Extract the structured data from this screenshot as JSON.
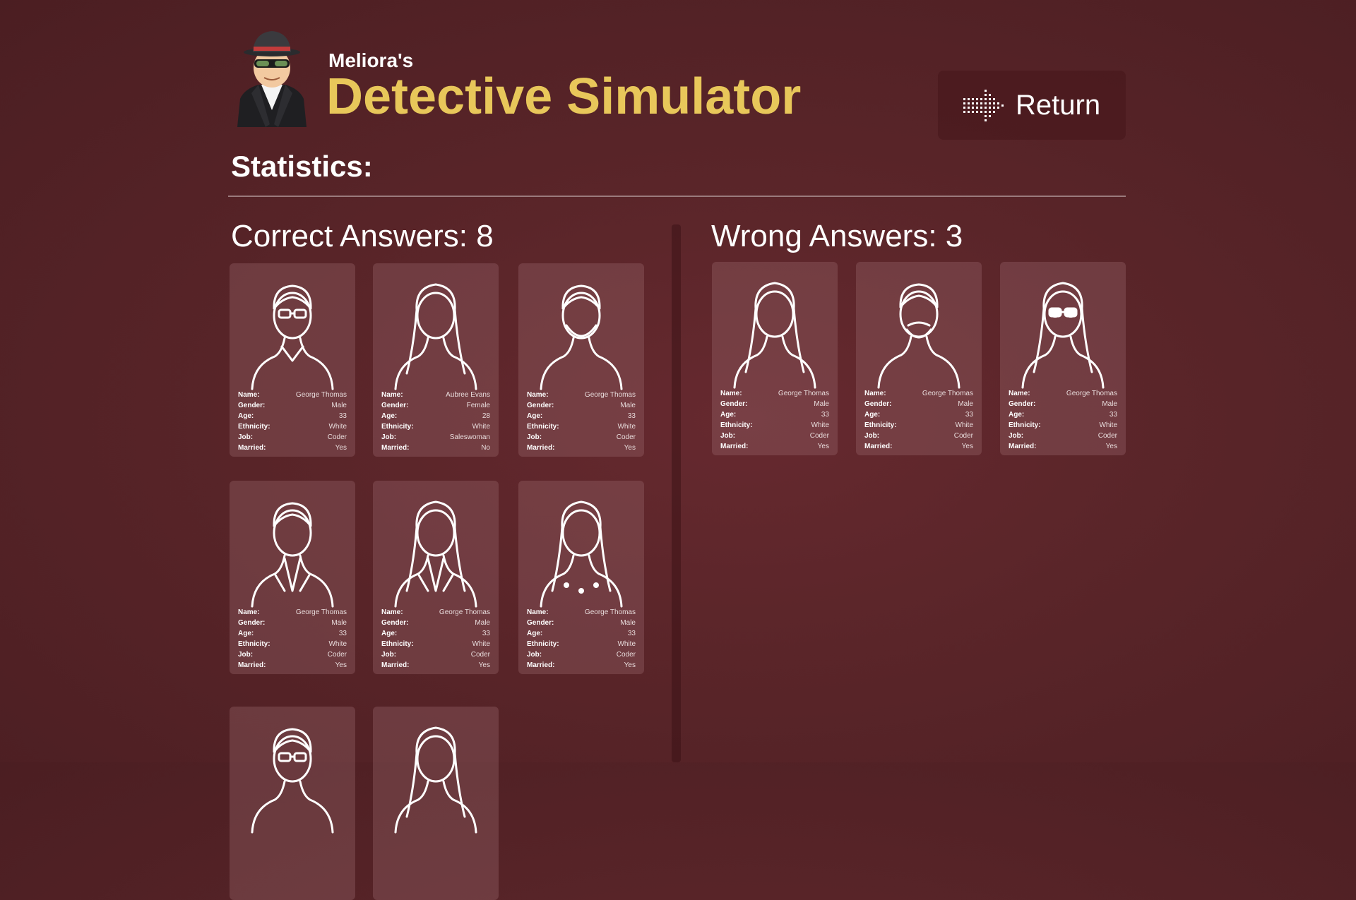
{
  "header": {
    "subtitle": "Meliora's",
    "title": "Detective Simulator",
    "return_label": "Return"
  },
  "statistics_label": "Statistics:",
  "correct": {
    "heading": "Correct Answers: 8",
    "cards": [
      {
        "name": "George Thomas",
        "gender": "Male",
        "age": "33",
        "ethnicity": "White",
        "job": "Coder",
        "married": "Yes",
        "portrait": "man-glasses-sweater"
      },
      {
        "name": "Aubree Evans",
        "gender": "Female",
        "age": "28",
        "ethnicity": "White",
        "job": "Saleswoman",
        "married": "No",
        "portrait": "woman-long-wavy-hair"
      },
      {
        "name": "George Thomas",
        "gender": "Male",
        "age": "33",
        "ethnicity": "White",
        "job": "Coder",
        "married": "Yes",
        "portrait": "man-beard"
      },
      {
        "name": "George Thomas",
        "gender": "Male",
        "age": "33",
        "ethnicity": "White",
        "job": "Coder",
        "married": "Yes",
        "portrait": "man-suit-tie"
      },
      {
        "name": "George Thomas",
        "gender": "Male",
        "age": "33",
        "ethnicity": "White",
        "job": "Coder",
        "married": "Yes",
        "portrait": "woman-blazer"
      },
      {
        "name": "George Thomas",
        "gender": "Male",
        "age": "33",
        "ethnicity": "White",
        "job": "Coder",
        "married": "Yes",
        "portrait": "woman-headband-flowers"
      },
      {
        "name": "",
        "gender": "",
        "age": "",
        "ethnicity": "",
        "job": "",
        "married": "",
        "portrait": "man-glasses"
      },
      {
        "name": "",
        "gender": "",
        "age": "",
        "ethnicity": "",
        "job": "",
        "married": "",
        "portrait": "woman-hair"
      }
    ]
  },
  "wrong": {
    "heading": "Wrong Answers: 3",
    "cards": [
      {
        "name": "George Thomas",
        "gender": "Male",
        "age": "33",
        "ethnicity": "White",
        "job": "Coder",
        "married": "Yes",
        "portrait": "woman-curly-hair"
      },
      {
        "name": "George Thomas",
        "gender": "Male",
        "age": "33",
        "ethnicity": "White",
        "job": "Coder",
        "married": "Yes",
        "portrait": "man-mustache"
      },
      {
        "name": "George Thomas",
        "gender": "Male",
        "age": "33",
        "ethnicity": "White",
        "job": "Coder",
        "married": "Yes",
        "portrait": "woman-sunglasses"
      }
    ]
  },
  "labels": {
    "name": "Name:",
    "gender": "Gender:",
    "age": "Age:",
    "ethnicity": "Ethnicity:",
    "job": "Job:",
    "married": "Married:"
  }
}
